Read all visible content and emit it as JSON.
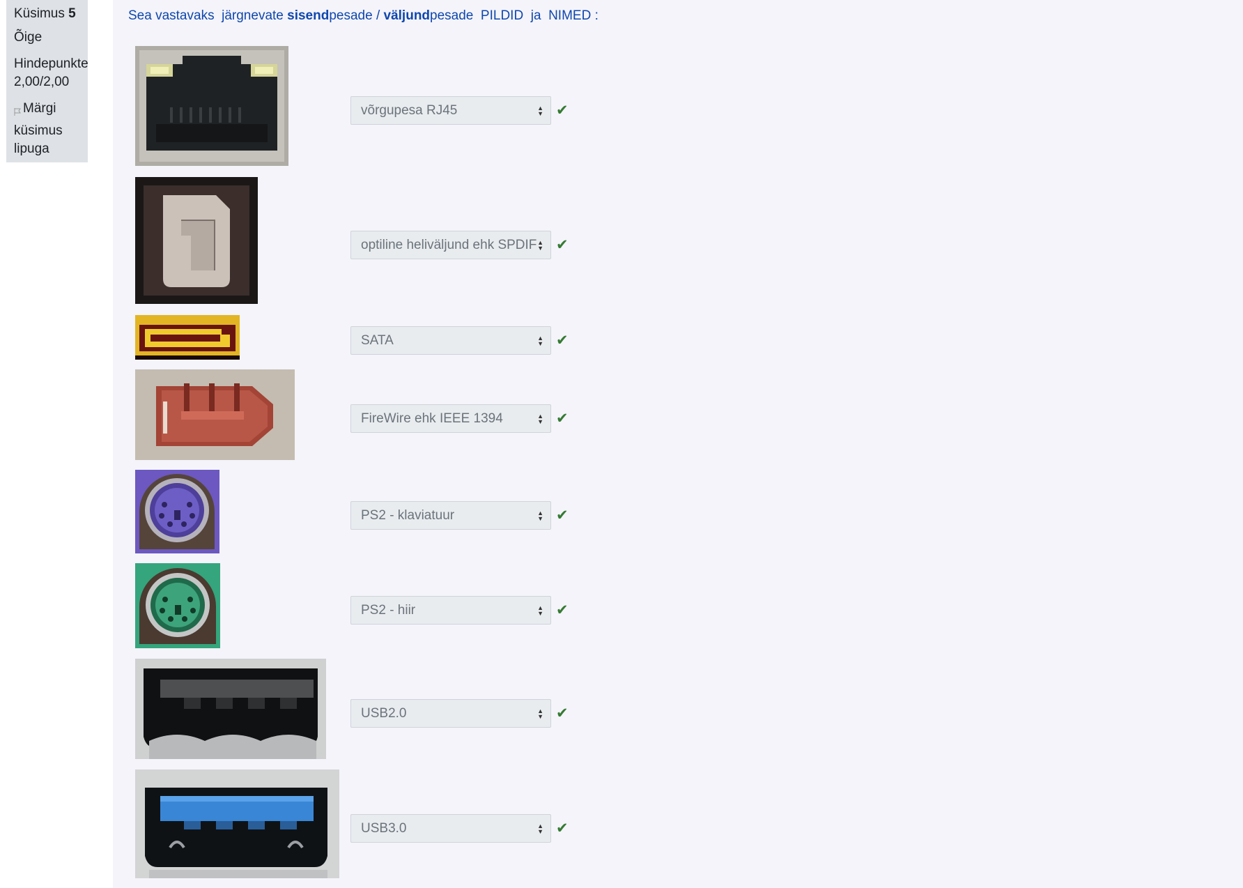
{
  "info": {
    "question_label": "Küsimus",
    "question_number": "5",
    "state": "Õige",
    "grade_label": "Hindepunkte",
    "grade_value": "2,00/2,00",
    "flag_text": "Märgi küsimus lipuga"
  },
  "question": {
    "t1": "Sea vastavaks  järgnevate ",
    "t2": "sisend",
    "t3": "pesade / ",
    "t4": "väljund",
    "t5": "pesade  PILDID  ja  NIMED :"
  },
  "rows": [
    {
      "image": "rj45-port-photo",
      "answer": "võrgupesa RJ45",
      "status": "correct"
    },
    {
      "image": "spdif-port-photo",
      "answer": "optiline heliväljund ehk SPDIF",
      "status": "correct"
    },
    {
      "image": "sata-port-photo",
      "answer": "SATA",
      "status": "correct"
    },
    {
      "image": "firewire-port-photo",
      "answer": "FireWire ehk IEEE 1394",
      "status": "correct"
    },
    {
      "image": "ps2-keyboard-port-photo",
      "answer": "PS2 - klaviatuur",
      "status": "correct"
    },
    {
      "image": "ps2-mouse-port-photo",
      "answer": "PS2 - hiir",
      "status": "correct"
    },
    {
      "image": "usb2-port-photo",
      "answer": "USB2.0",
      "status": "correct"
    },
    {
      "image": "usb3-port-photo",
      "answer": "USB3.0",
      "status": "correct"
    }
  ],
  "colors": {
    "link_blue": "#0f47ad",
    "correct_green": "#357a32",
    "select_bg": "#e9ecef",
    "info_bg": "#dee2e6"
  }
}
